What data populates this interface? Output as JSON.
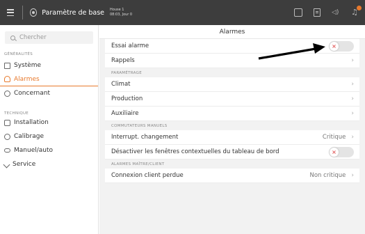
{
  "header": {
    "title": "Paramètre de base",
    "house_name": "House 1",
    "house_time": "08:03, Jour 0"
  },
  "sidebar": {
    "search_placeholder": "Chercher",
    "section_general": "GÉNÉRALITÉS",
    "section_technique": "TECHNIQUE",
    "items": [
      {
        "label": "Système",
        "icon": "system-icon"
      },
      {
        "label": "Alarmes",
        "icon": "alarm-icon"
      },
      {
        "label": "Concernant",
        "icon": "info-icon"
      },
      {
        "label": "Installation",
        "icon": "installation-icon"
      },
      {
        "label": "Calibrage",
        "icon": "calibration-icon"
      },
      {
        "label": "Manuel/auto",
        "icon": "manual-auto-icon"
      },
      {
        "label": "Service",
        "icon": "service-icon"
      }
    ]
  },
  "main": {
    "title": "Alarmes",
    "rows_top": [
      {
        "label": "Essai alarme"
      },
      {
        "label": "Rappels"
      }
    ],
    "group_parametrage": "PARAMÉTRAGE",
    "rows_param": [
      {
        "label": "Climat"
      },
      {
        "label": "Production"
      },
      {
        "label": "Auxiliaire"
      }
    ],
    "group_commutateurs": "COMMUTATEURS MANUELS",
    "row_interrupt": {
      "label": "Interrupt. changement",
      "value": "Critique"
    },
    "row_desactiver": {
      "label": "Désactiver les fenêtres contextuelles du tableau de bord"
    },
    "group_maitre": "ALARMES MAÎTRE/CLIENT",
    "row_connexion": {
      "label": "Connexion client perdue",
      "value": "Non critique"
    }
  },
  "colors": {
    "accent": "#e8792c",
    "topbar": "#3d3d3d",
    "toggle_off_x": "#e05a5a"
  }
}
